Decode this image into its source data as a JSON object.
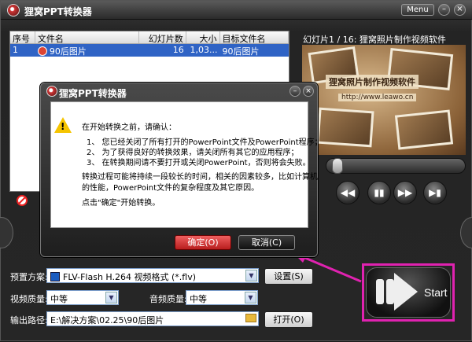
{
  "window": {
    "title": "狸窝PPT转换器",
    "menu_label": "Menu"
  },
  "file_table": {
    "columns": [
      "序号",
      "文件名",
      "幻灯片数",
      "大小",
      "目标文件名"
    ],
    "rows": [
      {
        "index": "1",
        "name": "90后图片",
        "slides": "16",
        "size": "1,03...",
        "target": "90后图片"
      }
    ]
  },
  "preview": {
    "title": "幻灯片1 / 16: 狸窝照片制作视频软件",
    "caption": "狸窝照片制作视频软件",
    "url": "http://www.leawo.cn"
  },
  "settings": {
    "preset_label": "预置方案:",
    "preset_value": "FLV-Flash H.264 视频格式 (*.flv)",
    "settings_button": "设置(S)",
    "video_quality_label": "视频质量:",
    "video_quality_value": "中等",
    "audio_quality_label": "音频质量:",
    "audio_quality_value": "中等",
    "output_label": "输出路径:",
    "output_value": "E:\\解决方案\\02.25\\90后图片",
    "open_button": "打开(O)",
    "start_label": "Start"
  },
  "dialog": {
    "title": "狸窝PPT转换器",
    "intro": "在开始转换之前，请确认：",
    "items": [
      "1、 您已经关闭了所有打开的PowerPoint文件及PowerPoint程序；",
      "2、 为了获得良好的转换效果，请关闭所有其它的应用程序；",
      "3、 在转换期间请不要打开或关闭PowerPoint，否则将会失败。"
    ],
    "note1": "转换过程可能将持续一段较长的时间，相关的因素较多，比如计算机",
    "note2": "的性能，PowerPoint文件的复杂程度及其它原因。",
    "note3": "点击\"确定\"开始转换。",
    "ok_button": "确定(O)",
    "cancel_button": "取消(C)"
  },
  "colors": {
    "highlight": "#e022b0",
    "selection": "#2f63c5",
    "ok_red": "#d33030"
  },
  "icons": [
    "app-logo-icon",
    "ppt-file-icon",
    "delete-icon",
    "warning-icon",
    "format-icon",
    "folder-icon",
    "play-forward-icon",
    "skip-end-icon",
    "rewind-icon",
    "start-arrow-icon"
  ]
}
